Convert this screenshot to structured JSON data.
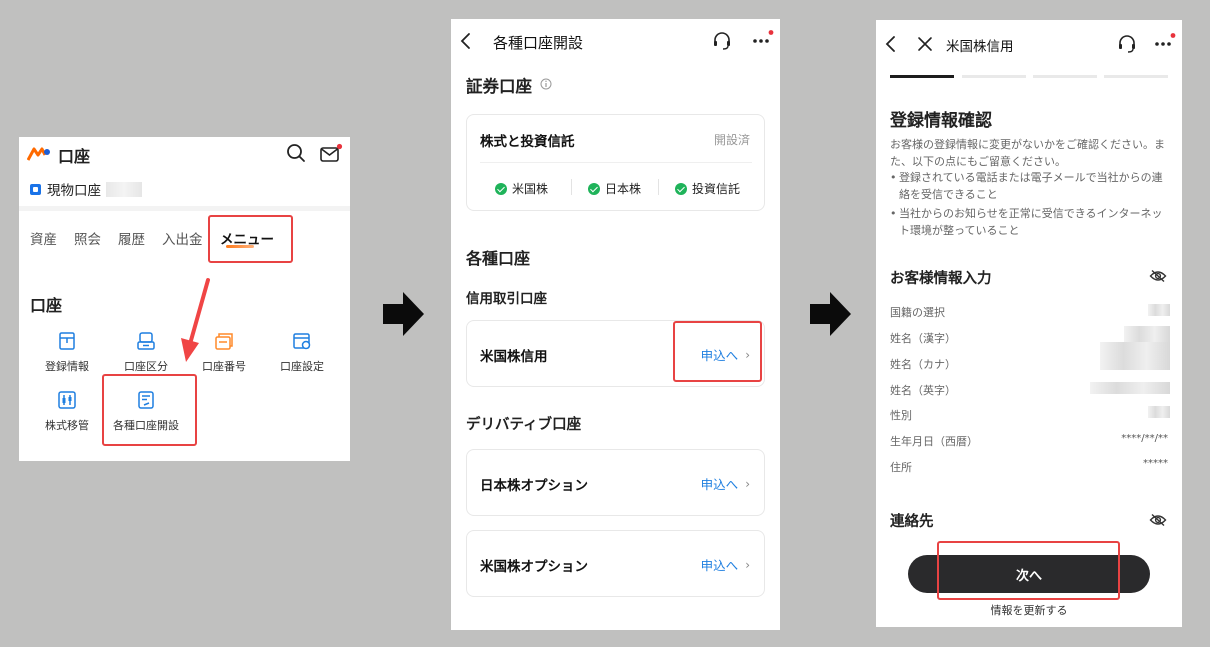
{
  "panel1": {
    "title": "口座",
    "account_label": "現物口座",
    "tabs": [
      "資産",
      "照会",
      "履歴",
      "入出金",
      "メニュー"
    ],
    "section_title": "口座",
    "menu_items": [
      {
        "label": "登録情報",
        "icon": "registration-icon"
      },
      {
        "label": "口座区分",
        "icon": "account-type-icon"
      },
      {
        "label": "口座番号",
        "icon": "account-number-icon"
      },
      {
        "label": "口座設定",
        "icon": "account-settings-icon"
      },
      {
        "label": "株式移管",
        "icon": "stock-transfer-icon"
      },
      {
        "label": "各種口座開設",
        "icon": "account-opening-icon"
      }
    ]
  },
  "panel2": {
    "header_title": "各種口座開設",
    "securities_title": "証券口座",
    "stocks_card": {
      "title": "株式と投資信託",
      "status": "開設済",
      "markets": [
        "米国株",
        "日本株",
        "投資信託"
      ]
    },
    "various_title": "各種口座",
    "margin_title": "信用取引口座",
    "us_margin": {
      "title": "米国株信用",
      "apply": "申込へ"
    },
    "derivatives_title": "デリバティブ口座",
    "jp_option": {
      "title": "日本株オプション",
      "apply": "申込へ"
    },
    "us_option": {
      "title": "米国株オプション",
      "apply": "申込へ"
    }
  },
  "panel3": {
    "header_title": "米国株信用",
    "progress_steps": 4,
    "progress_current": 1,
    "heading": "登録情報確認",
    "intro": "お客様の登録情報に変更がないかをご確認ください。また、以下の点にもご留意ください。",
    "bullets": [
      "登録されている電話または電子メールで当社からの連絡を受信できること",
      "当社からのお知らせを正常に受信できるインターネット環境が整っていること"
    ],
    "section_customer": "お客様情報入力",
    "fields": [
      {
        "label": "国籍の選択",
        "value": ""
      },
      {
        "label": "姓名（漢字）",
        "value": ""
      },
      {
        "label": "姓名（カナ）",
        "value": ""
      },
      {
        "label": "姓名（英字）",
        "value": ""
      },
      {
        "label": "性別",
        "value": ""
      },
      {
        "label": "生年月日（西暦）",
        "value": "****/**/**"
      },
      {
        "label": "住所",
        "value": "*****"
      }
    ],
    "section_contact": "連絡先",
    "next_button": "次へ",
    "update_link": "情報を更新する"
  },
  "colors": {
    "highlight": "#e84343",
    "accent_blue": "#1f7fe0",
    "check_green": "#1fb35a",
    "dark_button": "#2a2a2c",
    "notification_dot": "#e8323c"
  }
}
